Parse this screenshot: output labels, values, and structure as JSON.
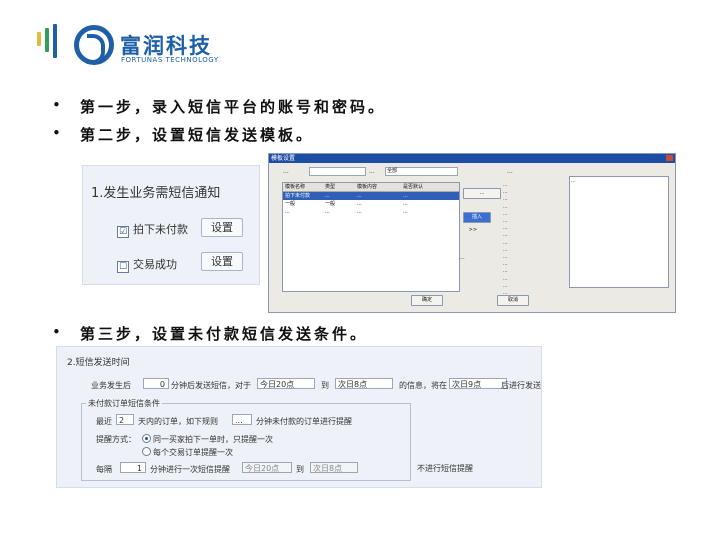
{
  "logo": {
    "cn": "富润科技",
    "en": "FORTUNAS TECHNOLOGY",
    "colors": {
      "primary": "#1f5fa8",
      "bar1": "#e8b83a",
      "bar2": "#2f9e5a",
      "bar3": "#1f5fa8"
    }
  },
  "bullets": {
    "b1": "第一步，录入短信平台的账号和密码。",
    "b2": "第二步，设置短信发送模板。",
    "b3": "第三步，设置未付款短信发送条件。",
    "glyph": "•"
  },
  "notify_panel": {
    "title": "1.发生业务需短信通知",
    "row1_check": "☑",
    "row1_label": "拍下未付款",
    "row1_button": "设置",
    "row2_check": "☐",
    "row2_label": "交易成功",
    "row2_button": "设置"
  },
  "template_window": {
    "title": "模板设置",
    "filter_label": "...",
    "category_label": "...",
    "category_value": "全部",
    "columns": [
      "模板名称",
      "类型",
      "模板内容",
      "是否默认"
    ],
    "rows": [
      [
        "拍下未付款",
        "...",
        "...",
        "..."
      ],
      [
        "一般",
        "一般",
        "...",
        "..."
      ],
      [
        "...",
        "...",
        "...",
        "..."
      ]
    ],
    "add_button": "...",
    "insert_button": "插入",
    "more_button": ">>",
    "var_title": "...",
    "variables": [
      "...",
      "...",
      "...",
      "...",
      "...",
      "...",
      "...",
      "...",
      "...",
      "...",
      "...",
      "...",
      "...",
      "...",
      "...",
      "..."
    ],
    "preview_text": "...",
    "ok_button": "确定",
    "cancel_button": "取消",
    "checkbox_label": "..."
  },
  "send_time": {
    "title": "2.短信发送时间",
    "l1_a": "业务发生后",
    "l1_hours": "0",
    "l1_b": "分钟后发送短信，对于",
    "l1_from": "今日20点",
    "l1_to_word": "到",
    "l1_to": "次日8点",
    "l1_c": "的信息，将在",
    "l1_at": "次日9点",
    "l1_d": "后进行发送",
    "group_title": "未付款订单短信条件",
    "g1_a": "最近",
    "g1_days": "2",
    "g1_b": "天内的订单，如下规则",
    "g1_sel": "...",
    "g1_c": "分钟未付款的订单进行提醒",
    "g2_a": "提醒方式：",
    "g2_opt1": "同一买家拍下一单时，只提醒一次",
    "g2_opt2": "每个交易订单提醒一次",
    "g3_a": "每隔",
    "g3_val": "1",
    "g3_b": "分钟进行一次短信提醒",
    "g3_from": "今日20点",
    "g3_to_word": "到",
    "g3_to": "次日8点",
    "g3_c": "不进行短信提醒"
  }
}
